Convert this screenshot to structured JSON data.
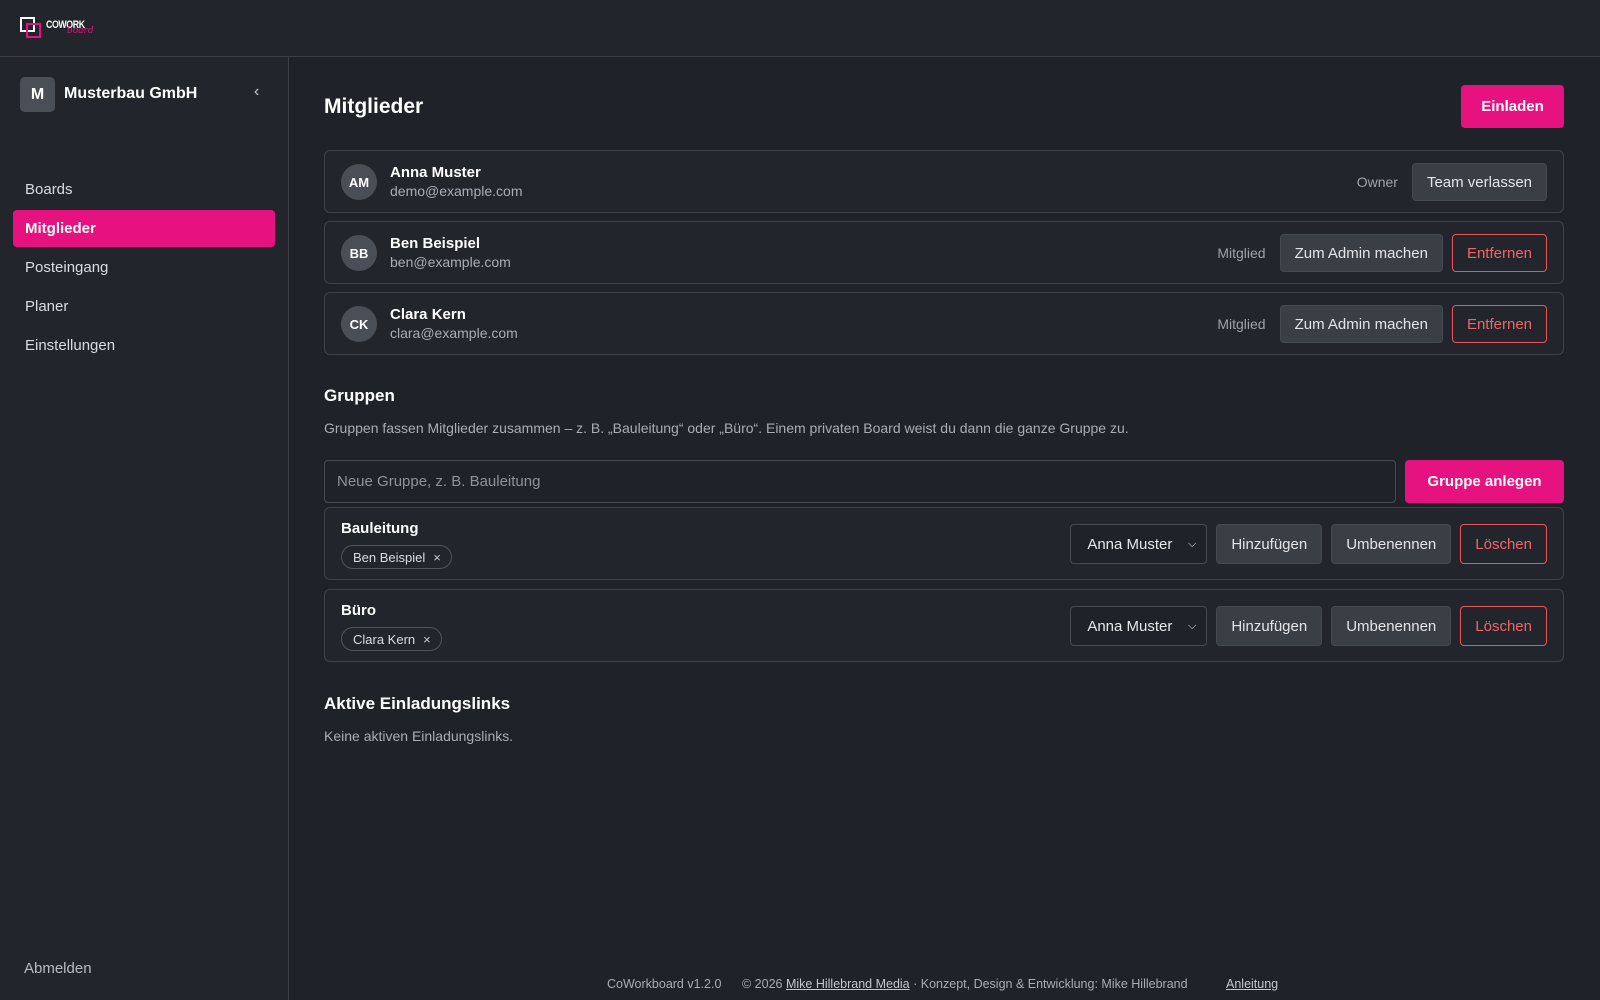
{
  "brand": {
    "logo_text": "COWORK",
    "logo_script": "board",
    "accent": "#e6127f"
  },
  "sidebar": {
    "team_initial": "M",
    "team_name": "Musterbau GmbH",
    "collapse_glyph": "‹",
    "items": [
      {
        "label": "Boards"
      },
      {
        "label": "Mitglieder",
        "active": true
      },
      {
        "label": "Posteingang"
      },
      {
        "label": "Planer"
      },
      {
        "label": "Einstellungen"
      }
    ],
    "logout_label": "Abmelden"
  },
  "main": {
    "title": "Mitglieder",
    "invite_label": "Einladen",
    "members": [
      {
        "initials": "AM",
        "name": "Anna Muster",
        "email": "demo@example.com",
        "role": "Owner",
        "leave_label": "Team verlassen"
      },
      {
        "initials": "BB",
        "name": "Ben Beispiel",
        "email": "ben@example.com",
        "role": "Mitglied",
        "admin_label": "Zum Admin machen",
        "remove_label": "Entfernen"
      },
      {
        "initials": "CK",
        "name": "Clara Kern",
        "email": "clara@example.com",
        "role": "Mitglied",
        "admin_label": "Zum Admin machen",
        "remove_label": "Entfernen"
      }
    ],
    "groups_section": {
      "title": "Gruppen",
      "description": "Gruppen fassen Mitglieder zusammen – z. B. „Bauleitung“ oder „Büro“. Einem privaten Board weist du dann die ganze Gruppe zu.",
      "input_placeholder": "Neue Gruppe, z. B. Bauleitung",
      "create_label": "Gruppe anlegen",
      "groups": [
        {
          "name": "Bauleitung",
          "members": [
            "Ben Beispiel"
          ],
          "selected": "Anna Muster",
          "add_label": "Hinzufügen",
          "rename_label": "Umbenennen",
          "delete_label": "Löschen"
        },
        {
          "name": "Büro",
          "members": [
            "Clara Kern"
          ],
          "selected": "Anna Muster",
          "add_label": "Hinzufügen",
          "rename_label": "Umbenennen",
          "delete_label": "Löschen"
        }
      ],
      "chip_remove_glyph": "×"
    },
    "invites_section": {
      "title": "Aktive Einladungslinks",
      "empty_text": "Keine aktiven Einladungslinks."
    }
  },
  "footer": {
    "version": "CoWorkboard v1.2.0",
    "copyright_prefix": "© 2026 ",
    "company_link": "Mike Hillebrand Media",
    "credits": " · Konzept, Design & Entwicklung: Mike Hillebrand",
    "guide_link": "Anleitung"
  }
}
